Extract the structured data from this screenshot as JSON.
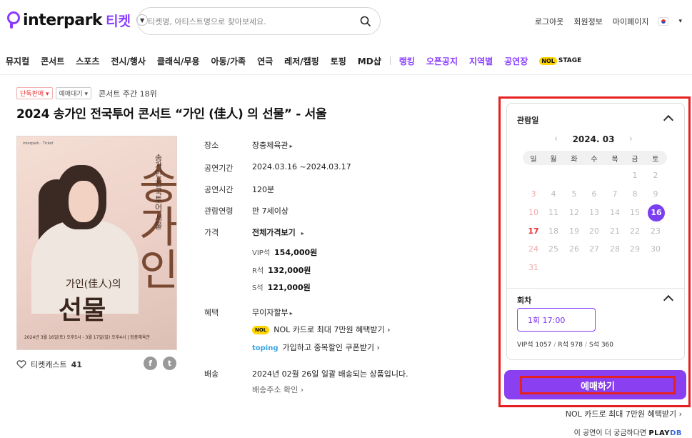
{
  "header": {
    "logo_text": "interpark",
    "logo_ticket": "티켓",
    "search_placeholder": "티켓명, 아티스트명으로 찾아보세요.",
    "links": [
      "로그아웃",
      "회원정보",
      "마이페이지"
    ]
  },
  "nav": {
    "items": [
      "뮤지컬",
      "콘서트",
      "스포츠",
      "전시/행사",
      "클래식/무용",
      "아동/가족",
      "연극",
      "레저/캠핑",
      "토핑",
      "MD샵"
    ],
    "purple_items": [
      "랭킹",
      "오픈공지",
      "지역별",
      "공연장"
    ],
    "nol_stage": "STAGE",
    "nol_badge": "NOL"
  },
  "product": {
    "tag1": "단독판매",
    "tag2": "예매대기",
    "rank": "콘서트 주간 18위",
    "title": "2024 송가인 전국투어 콘서트 “가인 (佳人) 의 선물” - 서울",
    "poster": {
      "top_line": "interpark · Ticket",
      "vertical": "송가인 전국투어 서울",
      "big": "송가인",
      "subtitle": "가인(佳人)의",
      "main": "선물",
      "bottom": "2024년 3월 16일(토) 오후5시 - 3월 17일(일) 오후4시 | 장충체육관"
    },
    "cast_label": "티켓캐스트",
    "cast_count": "41"
  },
  "info": {
    "venue_label": "장소",
    "venue_value": "장충체육관",
    "period_label": "공연기간",
    "period_value": "2024.03.16 ~2024.03.17",
    "runtime_label": "공연시간",
    "runtime_value": "120분",
    "age_label": "관람연령",
    "age_value": "만 7세이상",
    "price_label": "가격",
    "price_value": "전체가격보기",
    "prices": [
      {
        "seat": "VIP석",
        "price": "154,000원"
      },
      {
        "seat": "R석",
        "price": "132,000원"
      },
      {
        "seat": "S석",
        "price": "121,000원"
      }
    ],
    "benefit_label": "혜택",
    "benefit_value": "무이자할부",
    "benefit_nol": "NOL 카드로 최대 7만원 혜택받기",
    "benefit_toping_brand": "toping",
    "benefit_toping": "가입하고 중복할인 쿠폰받기",
    "delivery_label": "배송",
    "delivery_value": "2024년 02월 26일 일괄 배송되는 상품입니다.",
    "delivery_link": "배송주소 확인"
  },
  "booking": {
    "date_header": "관람일",
    "month": "2024. 03",
    "weekdays": [
      "일",
      "월",
      "화",
      "수",
      "목",
      "금",
      "토"
    ],
    "weeks": [
      [
        "",
        "",
        "",
        "",
        "",
        "1",
        "2"
      ],
      [
        "3",
        "4",
        "5",
        "6",
        "7",
        "8",
        "9"
      ],
      [
        "10",
        "11",
        "12",
        "13",
        "14",
        "15",
        "16"
      ],
      [
        "17",
        "18",
        "19",
        "20",
        "21",
        "22",
        "23"
      ],
      [
        "24",
        "25",
        "26",
        "27",
        "28",
        "29",
        "30"
      ],
      [
        "31",
        "",
        "",
        "",
        "",
        "",
        ""
      ]
    ],
    "selected_day": "16",
    "session_header": "회차",
    "session_value": "1회 17:00",
    "seats_vip": "VIP석 1057",
    "seats_r": "R석 978",
    "seats_s": "S석 360",
    "book_button": "예매하기",
    "promo": "NOL 카드로 최대 7만원 혜택받기",
    "playdb_text": "이 공연이 더 궁금하다면",
    "playdb_brand_a": "PLAY",
    "playdb_brand_b": "DB"
  },
  "colors": {
    "accent": "#8b3dff",
    "highlight_box": "#e62020"
  }
}
